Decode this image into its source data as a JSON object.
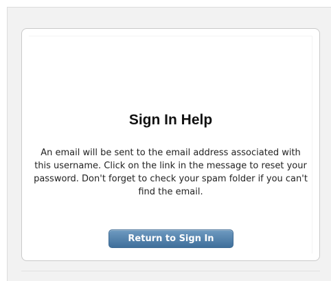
{
  "dialog": {
    "title": "Sign In Help",
    "message": "An email will be sent to the email address associated with this username. Click on the link in the message to reset your password. Don't forget to check your spam folder if you can't find the email.",
    "return_button_label": "Return to Sign In"
  },
  "colors": {
    "button_top": "#6e9ac0",
    "button_bottom": "#3f6f9b",
    "panel_background": "#f2f2f2",
    "card_border": "#c9c9c9"
  }
}
